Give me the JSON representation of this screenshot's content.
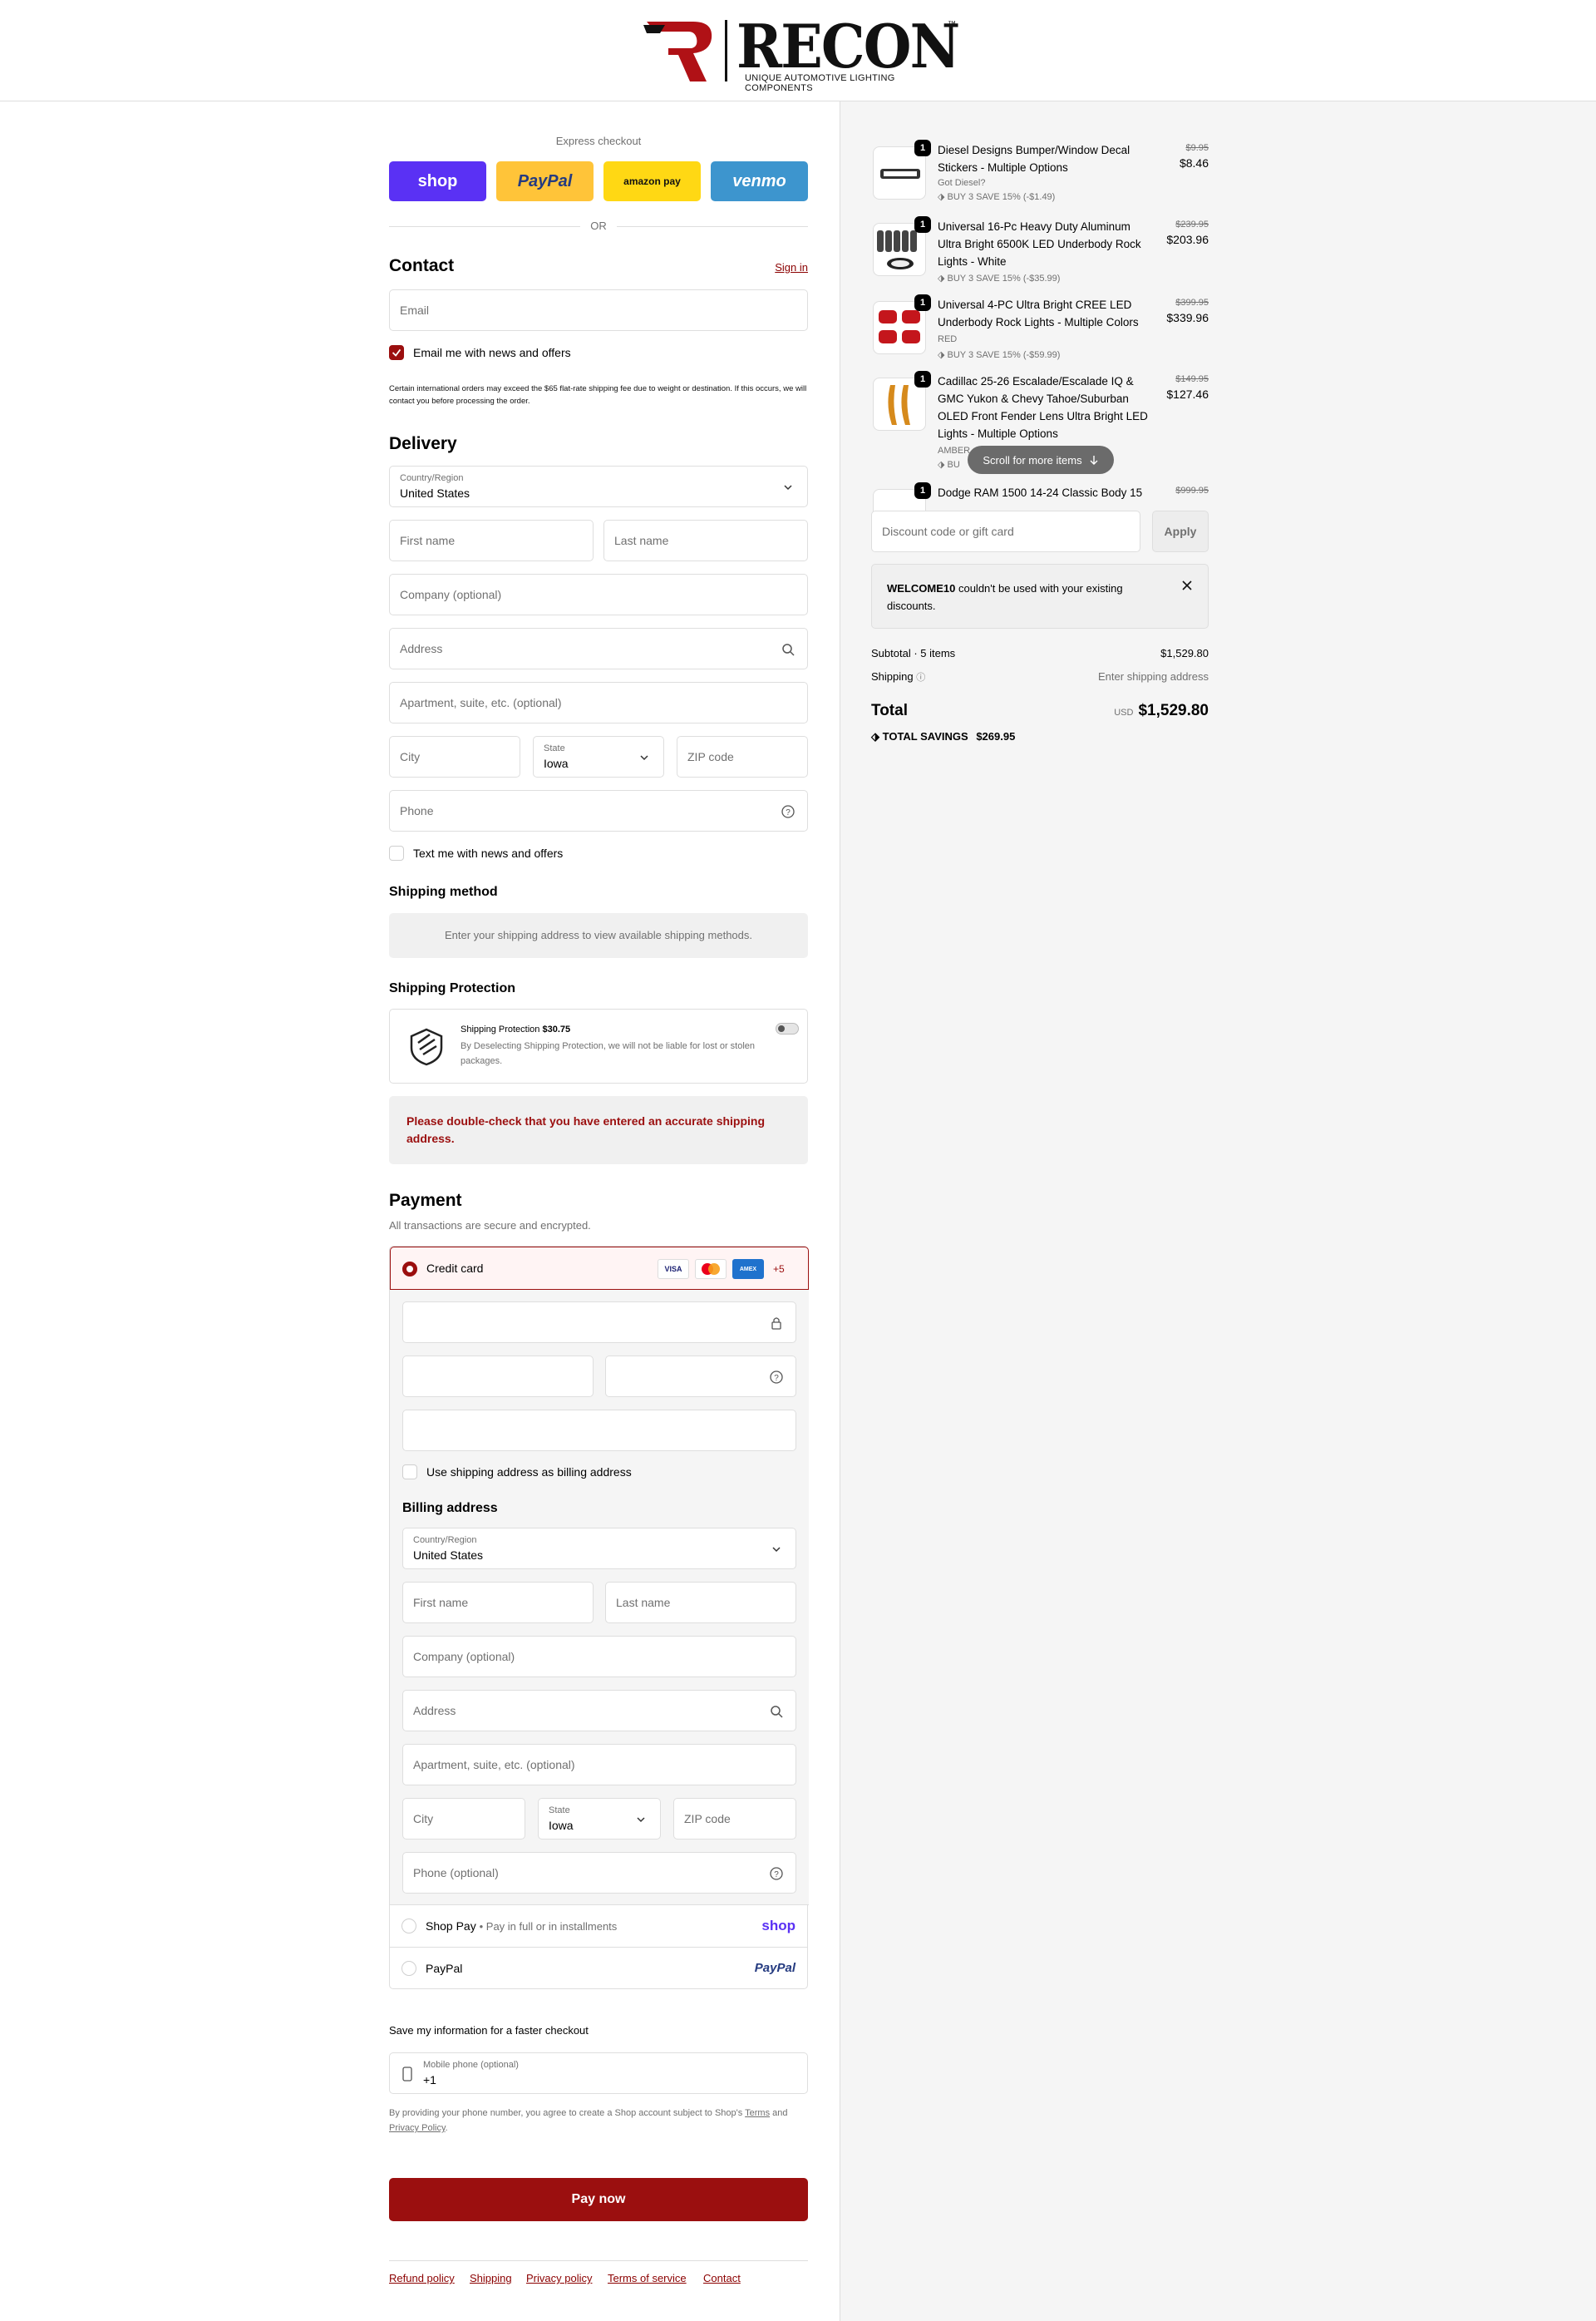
{
  "brand": {
    "name": "RECON",
    "tagline": "UNIQUE AUTOMOTIVE LIGHTING COMPONENTS",
    "tm": "™",
    "accent": "#9b0f0f"
  },
  "express": {
    "title": "Express checkout",
    "buttons": [
      {
        "label": "shop",
        "color": "#5a31f4"
      },
      {
        "label": "PayPal",
        "color": "#ffc439"
      },
      {
        "label": "amazon pay",
        "color": "#ffd814"
      },
      {
        "label": "venmo",
        "color": "#3d95ce"
      }
    ],
    "or": "OR"
  },
  "contact": {
    "title": "Contact",
    "sign_in": "Sign in",
    "email_placeholder": "Email",
    "news_label": "Email me with news and offers",
    "news_checked": true,
    "notice": "Certain international orders may exceed the $65 flat-rate shipping fee due to weight or destination. If this occurs, we will contact you before processing the order."
  },
  "delivery": {
    "title": "Delivery",
    "country_label": "Country/Region",
    "country": "United States",
    "first_name": "First name",
    "last_name": "Last name",
    "company": "Company (optional)",
    "address": "Address",
    "apartment": "Apartment, suite, etc. (optional)",
    "city": "City",
    "state_label": "State",
    "state": "Iowa",
    "zip": "ZIP code",
    "phone": "Phone",
    "sms_label": "Text me with news and offers",
    "sms_checked": false
  },
  "shipping_method": {
    "title": "Shipping method",
    "message": "Enter your shipping address to view available shipping methods."
  },
  "shipping_protection": {
    "title": "Shipping Protection",
    "name": "Shipping Protection",
    "price": "$30.75",
    "description": "By Deselecting Shipping Protection, we will not be liable for lost or stolen packages.",
    "enabled": false
  },
  "warning": "Please double-check that you have entered an accurate shipping address.",
  "payment": {
    "title": "Payment",
    "subtitle": "All transactions are secure and encrypted.",
    "credit_card": "Credit card",
    "card_brands": [
      "VISA",
      "MC",
      "AMEX"
    ],
    "more_brands": "+5",
    "use_shipping_as_billing": "Use shipping address as billing address",
    "billing": {
      "title": "Billing address",
      "country_label": "Country/Region",
      "country": "United States",
      "first_name": "First name",
      "last_name": "Last name",
      "company": "Company (optional)",
      "address": "Address",
      "apartment": "Apartment, suite, etc. (optional)",
      "city": "City",
      "state_label": "State",
      "state": "Iowa",
      "zip": "ZIP code",
      "phone": "Phone (optional)"
    },
    "shop_pay": {
      "label": "Shop Pay",
      "sub": "Pay in full or in installments",
      "logo": "shop"
    },
    "paypal": {
      "label": "PayPal",
      "logo": "PayPal"
    }
  },
  "remember": {
    "title": "Save my information for a faster checkout",
    "phone_label": "Mobile phone (optional)",
    "phone_prefix": "+1",
    "consent_prefix": "By providing your phone number, you agree to create a Shop account subject to Shop's",
    "terms": "Terms",
    "and": "and",
    "privacy": "Privacy Policy",
    "period": "."
  },
  "pay_now": "Pay now",
  "footer_links": [
    "Refund policy",
    "Shipping",
    "Privacy policy",
    "Terms of service",
    "Contact"
  ],
  "cart": {
    "items": [
      {
        "qty": "1",
        "name": "Diesel Designs Bumper/Window Decal Stickers - Multiple Options",
        "variant": "Got Diesel?",
        "discount": "BUY 3 SAVE 15% (-$1.49)",
        "old_price": "$9.95",
        "price": "$8.46"
      },
      {
        "qty": "1",
        "name": "Universal 16-Pc Heavy Duty Aluminum Ultra Bright 6500K LED Underbody Rock Lights - White",
        "variant": "",
        "discount": "BUY 3 SAVE 15% (-$35.99)",
        "old_price": "$239.95",
        "price": "$203.96"
      },
      {
        "qty": "1",
        "name": "Universal 4-PC Ultra Bright CREE LED Underbody Rock Lights - Multiple Colors",
        "variant": "RED",
        "discount": "BUY 3 SAVE 15% (-$59.99)",
        "old_price": "$399.95",
        "price": "$339.96"
      },
      {
        "qty": "1",
        "name": "Cadillac 25-26 Escalade/Escalade IQ & GMC Yukon & Chevy Tahoe/Suburban OLED Front Fender Lens Ultra Bright LED Lights - Multiple Options",
        "variant": "AMBER",
        "discount": "BU",
        "old_price": "$149.95",
        "price": "$127.46"
      },
      {
        "qty": "1",
        "name": "Dodge RAM 1500 14-24 Classic Body 15",
        "old_price": "$999.95"
      }
    ],
    "scroll_hint": "Scroll for more items",
    "discount_placeholder": "Discount code or gift card",
    "apply": "Apply",
    "notice_code": "WELCOME10",
    "notice_text": "couldn't be used with your existing discounts.",
    "subtotal_label": "Subtotal · 5 items",
    "subtotal": "$1,529.80",
    "shipping_label": "Shipping",
    "shipping_value": "Enter shipping address",
    "total_label": "Total",
    "currency": "USD",
    "total": "$1,529.80",
    "savings_label": "TOTAL SAVINGS",
    "savings": "$269.95"
  }
}
